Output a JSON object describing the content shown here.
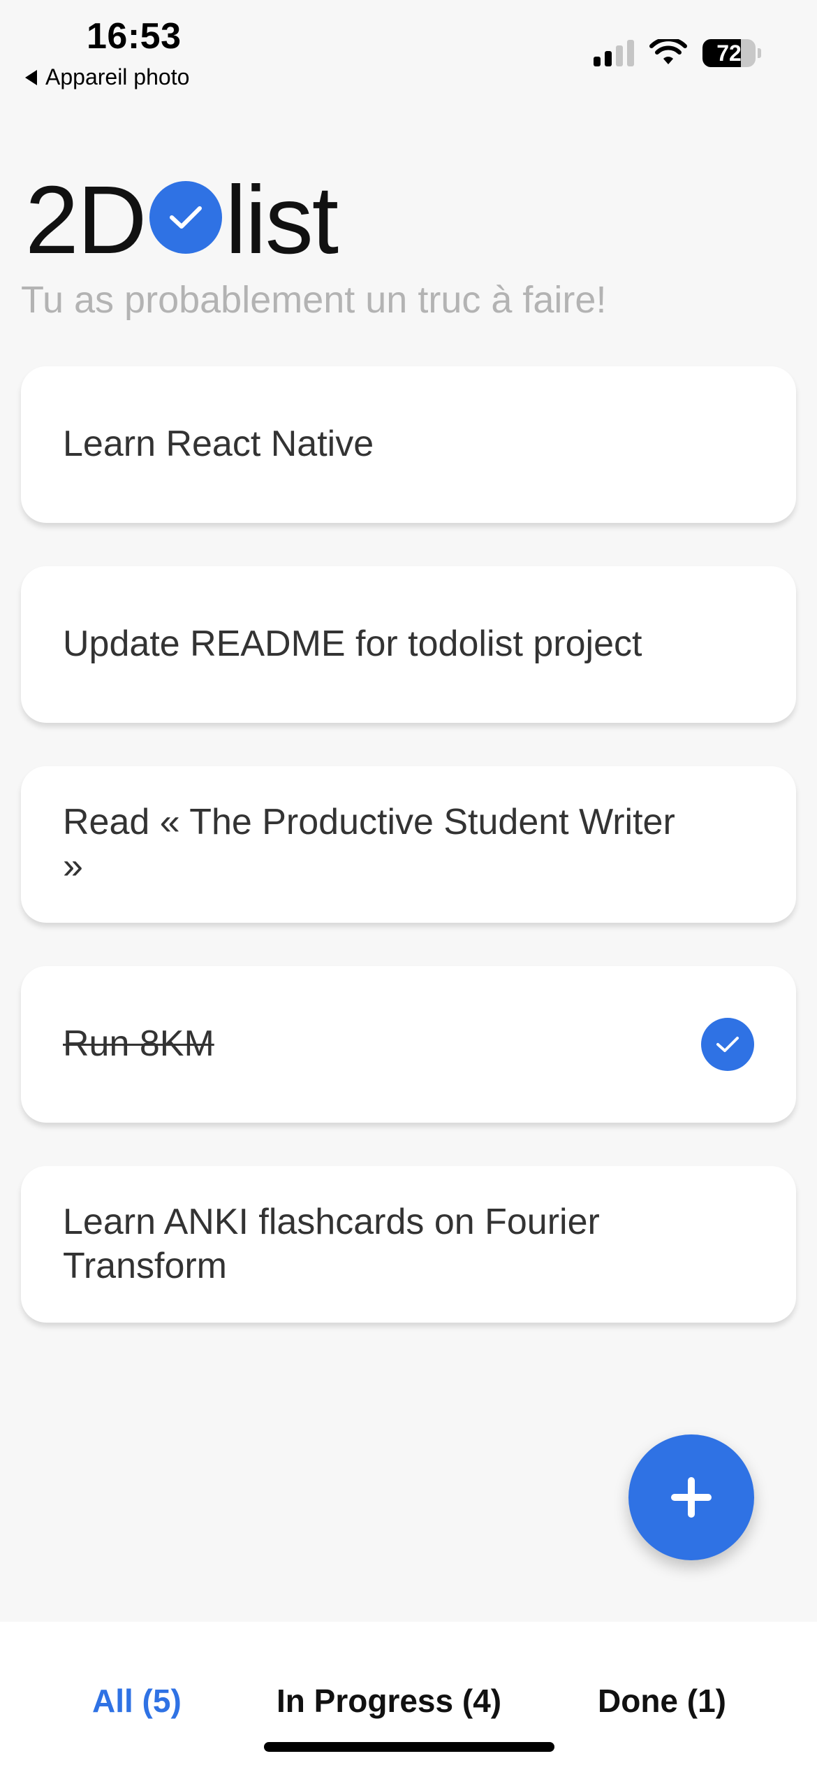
{
  "status_bar": {
    "time": "16:53",
    "back_label": "Appareil photo",
    "battery_level": "72",
    "battery_percent": 72,
    "signal_bars": 4,
    "signal_bars_active": 2
  },
  "header": {
    "logo_prefix": "2D",
    "logo_suffix": "list",
    "subtitle": "Tu as probablement un truc à faire!"
  },
  "tasks": [
    {
      "title": "Learn React Native",
      "done": false
    },
    {
      "title": "Update README for todolist project",
      "done": false
    },
    {
      "title": "Read « The Productive Student Writer »",
      "done": false
    },
    {
      "title": "Run 8KM",
      "done": true
    },
    {
      "title": "Learn ANKI flashcards on Fourier Transform",
      "done": false
    }
  ],
  "tabs": {
    "all": "All (5)",
    "in_progress": "In Progress (4)",
    "done": "Done (1)",
    "active": "all"
  },
  "colors": {
    "accent": "#2f72e4",
    "background": "#f7f7f7",
    "subtitle": "#b3b3b3"
  },
  "icons": {
    "back": "back-triangle-icon",
    "signal": "cellular-signal-icon",
    "wifi": "wifi-icon",
    "battery": "battery-icon",
    "logo_check": "checkmark-circle-icon",
    "task_done": "checkmark-icon",
    "add": "plus-icon"
  }
}
